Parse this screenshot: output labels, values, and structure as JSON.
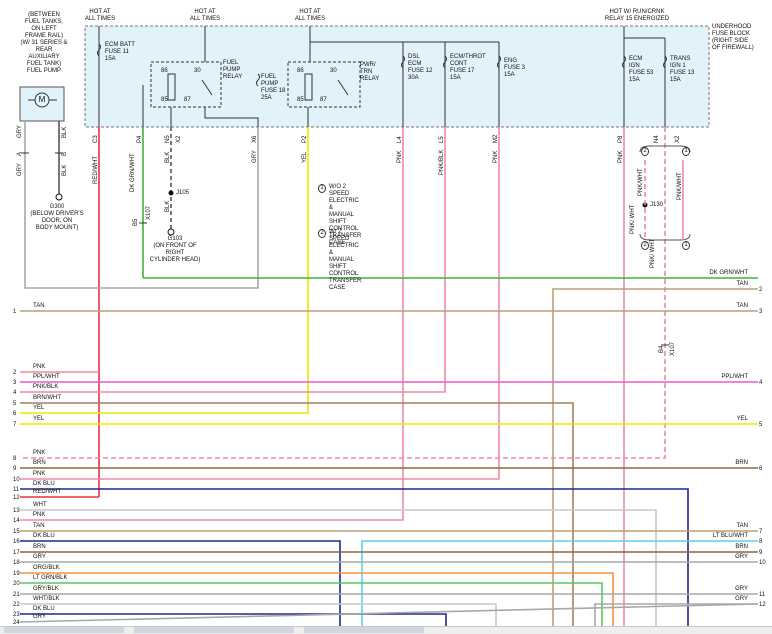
{
  "top_labels": {
    "left_header": "(BETWEEN\nFUEL TANKS,\nON LEFT\nFRAME RAIL)\n(W/ 31 SERIES &\nREAR\nAUXILIARY\nFUEL TANK)\nFUEL PUMP",
    "hot1": "HOT AT\nALL TIMES",
    "hot2": "HOT AT\nALL TIMES",
    "hot3": "HOT AT\nALL TIMES",
    "hot4": "HOT W/ RUN/CRNK\nRELAY 15 ENERGIZED",
    "fuse_block": "UNDERHOOD\nFUSE BLOCK\n(RIGHT SIDE\nOF FIREWALL)"
  },
  "components": {
    "motor": "M",
    "ecm_batt": "ECM BATT\nFUSE 11\n15A",
    "fuel_pump_relay": "FUEL\nPUMP\nRELAY",
    "fuel_pump_fuse": "FUEL\nPUMP\nFUSE 18\n25A",
    "pwr_trn_relay": "PWR/\nTRN\nRELAY",
    "dsl_ecm": "DSL\nECM\nFUSE 12\n30A",
    "ecm_throt": "ECM/THROT\nCONT\nFUSE 17\n15A",
    "eng_fuse": "ENG\nFUSE 3\n15A",
    "ecm_ign": "ECM\nIGN\nFUSE 53\n15A",
    "trans_ign": "TRANS\nIGN 1\nFUSE 13\n15A",
    "relay_pins": [
      "86",
      "30",
      "85",
      "87",
      "86",
      "30",
      "85",
      "87"
    ]
  },
  "pins": [
    "C3",
    "P4",
    "N5",
    "X2",
    "X6",
    "P2",
    "L4",
    "L5",
    "M2",
    "P8",
    "N4",
    "X2"
  ],
  "wire_labels_top": [
    "GRY",
    "BLK",
    "GRY",
    "BLK",
    "RED/WHT",
    "DK GRN/WHT",
    "BLK",
    "GRY",
    "YEL",
    "PNK",
    "PNK/BLK",
    "PNK",
    "PNK",
    "BLK",
    "PNK/WHT",
    "PNK/WHT",
    "PNK/\nWHT",
    "PNK/\nWHT"
  ],
  "connectors": [
    "A",
    "B",
    "B5",
    "X107",
    "B4",
    "X107"
  ],
  "grounds": {
    "g300": "G300\n(BELOW DRIVER'S\nDOOR, ON\nBODY MOUNT)",
    "g103": "G103\n(ON FRONT OF\nRIGHT\nCYLINDER HEAD)"
  },
  "splices": [
    "J105",
    "J130"
  ],
  "notes": [
    {
      "num": "1",
      "text": "W/O 2 SPEED\nELECTRIC &\nMANUAL SHIFT\nCONTROL\nTRANSFER CASE"
    },
    {
      "num": "2",
      "text": "W/ 2 SPEED\nELECTRIC &\nMANUAL SHIFT\nCONTROL\nTRANSFER CASE"
    }
  ],
  "option_markers": [
    "1",
    "2",
    "2",
    "1"
  ],
  "left_wires": [
    {
      "num": "1",
      "label": "TAN",
      "color": "#b8a07a"
    },
    {
      "num": "2",
      "label": "PNK",
      "color": "#f08aa0"
    },
    {
      "num": "3",
      "label": "PPL/WHT",
      "color": "#e65ad2"
    },
    {
      "num": "4",
      "label": "PNK/BLK",
      "color": "#f08aa0"
    },
    {
      "num": "5",
      "label": "BRN/WHT",
      "color": "#a08060"
    },
    {
      "num": "6",
      "label": "YEL",
      "color": "#f2e600"
    },
    {
      "num": "7",
      "label": "YEL",
      "color": "#f2e600"
    },
    {
      "num": "8",
      "label": "PNK",
      "color": "#f08aa0"
    },
    {
      "num": "9",
      "label": "BRN",
      "color": "#8b6a3a"
    },
    {
      "num": "10",
      "label": "PNK",
      "color": "#f08aa0"
    },
    {
      "num": "11",
      "label": "DK BLU",
      "color": "#1a2a8a"
    },
    {
      "num": "12",
      "label": "RED/WHT",
      "color": "#e8323c"
    },
    {
      "num": "13",
      "label": "WHT",
      "color": "#c8c8c8"
    },
    {
      "num": "14",
      "label": "PNK",
      "color": "#f08aa0"
    },
    {
      "num": "15",
      "label": "TAN",
      "color": "#b8a07a"
    },
    {
      "num": "16",
      "label": "DK BLU",
      "color": "#1a2a8a"
    },
    {
      "num": "17",
      "label": "BRN",
      "color": "#8b6a3a"
    },
    {
      "num": "18",
      "label": "GRY",
      "color": "#a8a8a8"
    },
    {
      "num": "19",
      "label": "ORG/BLK",
      "color": "#f0963c"
    },
    {
      "num": "20",
      "label": "LT GRN/BLK",
      "color": "#5ac85a"
    },
    {
      "num": "21",
      "label": "GRY/BLK",
      "color": "#a8a8a8"
    },
    {
      "num": "22",
      "label": "WHT/BLK",
      "color": "#c8c8c8"
    },
    {
      "num": "23",
      "label": "DK BLU",
      "color": "#1a2a8a"
    },
    {
      "num": "24",
      "label": "GRY",
      "color": "#a8a8a8"
    }
  ],
  "right_wires": [
    {
      "num": "",
      "label": "DK GRN/WHT",
      "color": "#3cb43c"
    },
    {
      "num": "2",
      "label": "TAN",
      "color": "#b8a07a"
    },
    {
      "num": "3",
      "label": "TAN",
      "color": "#b8a07a"
    },
    {
      "num": "4",
      "label": "PPL/WHT",
      "color": "#e65ad2"
    },
    {
      "num": "5",
      "label": "YEL",
      "color": "#f2e600"
    },
    {
      "num": "6",
      "label": "BRN",
      "color": "#8b6a3a"
    },
    {
      "num": "7",
      "label": "TAN",
      "color": "#b8a07a"
    },
    {
      "num": "8",
      "label": "LT BLU/WHT",
      "color": "#5ad2e6"
    },
    {
      "num": "9",
      "label": "BRN",
      "color": "#8b6a3a"
    },
    {
      "num": "10",
      "label": "GRY",
      "color": "#a8a8a8"
    },
    {
      "num": "11",
      "label": "GRY",
      "color": "#a8a8a8"
    },
    {
      "num": "12",
      "label": "GRY",
      "color": "#a8a8a8"
    }
  ],
  "colors": {
    "fuse_block_fill": "#e2f2fa",
    "fuse_block_border": "#777777",
    "ground_wire": "#555555"
  }
}
